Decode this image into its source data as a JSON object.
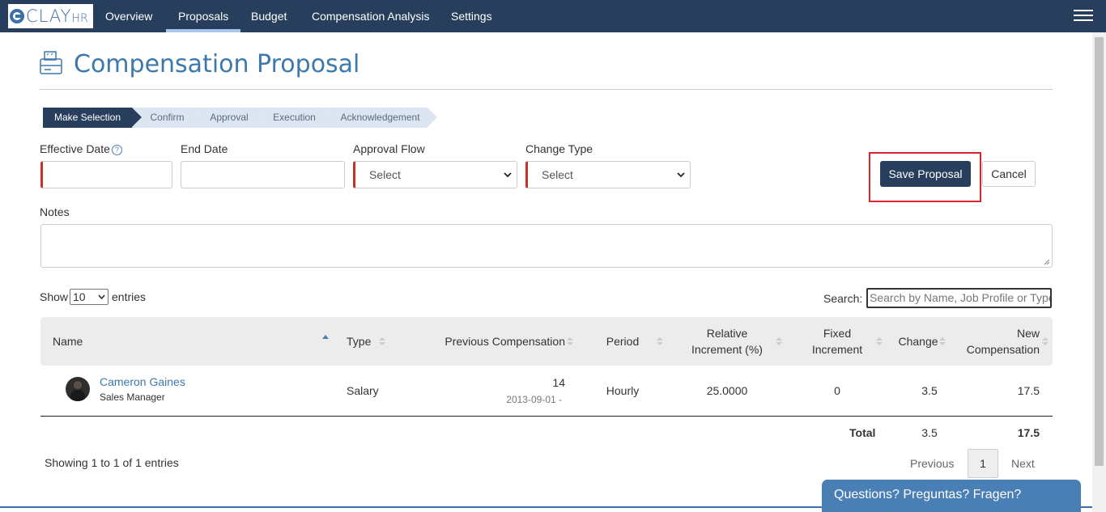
{
  "app": {
    "logo_text": "CLAY",
    "logo_suffix": "HR"
  },
  "nav": {
    "items": [
      "Overview",
      "Proposals",
      "Budget",
      "Compensation Analysis",
      "Settings"
    ],
    "active": "Proposals"
  },
  "page": {
    "title": "Compensation Proposal"
  },
  "steps": [
    "Make Selection",
    "Confirm",
    "Approval",
    "Execution",
    "Acknowledgement"
  ],
  "form": {
    "effective_date_label": "Effective Date",
    "effective_date_help": "?",
    "end_date_label": "End Date",
    "approval_flow_label": "Approval Flow",
    "approval_flow_value": "Select",
    "change_type_label": "Change Type",
    "change_type_value": "Select",
    "notes_label": "Notes",
    "save_label": "Save Proposal",
    "cancel_label": "Cancel"
  },
  "table_controls": {
    "show_label": "Show",
    "page_length": "10",
    "entries_label": "entries",
    "search_label": "Search:",
    "search_placeholder": "Search by Name, Job Profile or Type"
  },
  "table": {
    "headers": {
      "name": "Name",
      "type": "Type",
      "previous_compensation": "Previous Compensation",
      "period": "Period",
      "relative_increment_1": "Relative",
      "relative_increment_2": "Increment (%)",
      "fixed_increment_1": "Fixed",
      "fixed_increment_2": "Increment",
      "change": "Change",
      "new_compensation_1": "New",
      "new_compensation_2": "Compensation"
    },
    "rows": [
      {
        "name": "Cameron Gaines",
        "job": "Sales Manager",
        "type": "Salary",
        "previous_compensation": "14",
        "previous_date": "2013-09-01 -",
        "period": "Hourly",
        "relative_increment": "25.0000",
        "fixed_increment": "0",
        "change": "3.5",
        "new_compensation": "17.5"
      }
    ],
    "totals": {
      "label": "Total",
      "change": "3.5",
      "new_compensation": "17.5"
    }
  },
  "pagination": {
    "info": "Showing 1 to 1 of 1 entries",
    "previous": "Previous",
    "current": "1",
    "next": "Next"
  },
  "chat": {
    "label": "Questions? Preguntas? Fragen?"
  },
  "colors": {
    "nav_bg": "#273f5c",
    "accent": "#3d79ad",
    "required": "#c9302c",
    "highlight_frame": "#d9232d"
  }
}
